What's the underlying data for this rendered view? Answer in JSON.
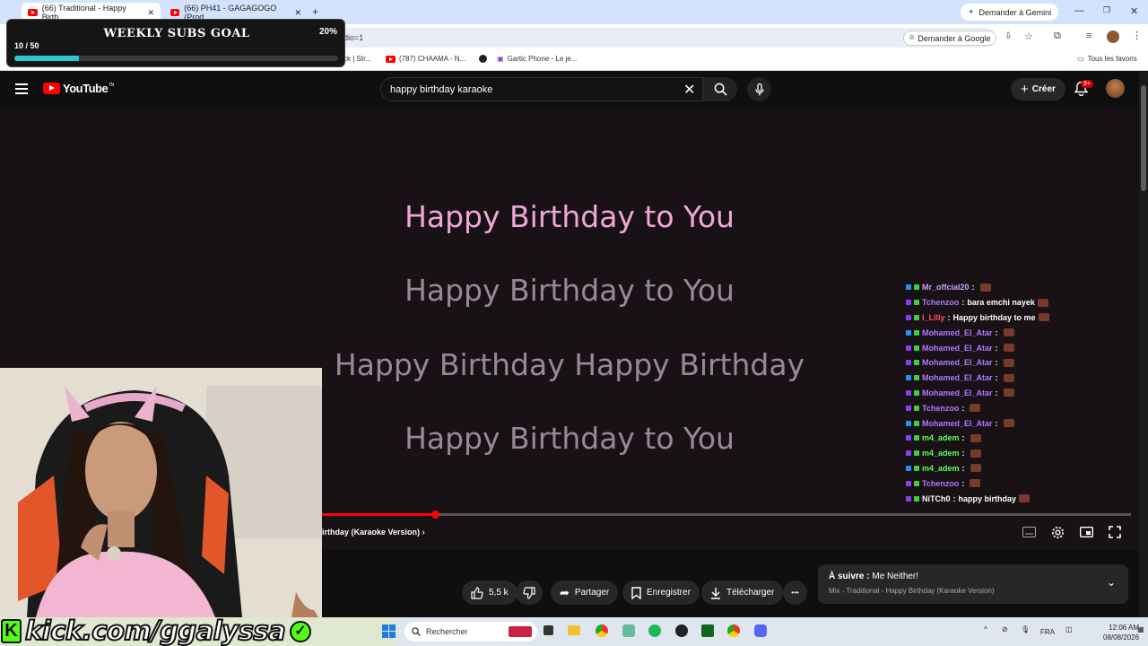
{
  "browser": {
    "tabs": [
      {
        "title": "(66) Traditional - Happy Birth"
      },
      {
        "title": "(66) PH41 - GAGAGOGO (Prod"
      }
    ],
    "new_tab": "+",
    "gemini": "Demander à Gemini",
    "url_fragment": "dio=1",
    "translate_label": "Demander à Google",
    "bookmarks": [
      "ck | Str...",
      "(787) CHAAMA - N...",
      "",
      "Gartic Phone - Le je..."
    ],
    "all_bookmarks": "Tous les favoris"
  },
  "overlay": {
    "subs_title": "WEEKLY SUBS GOAL",
    "subs_percent": "20%",
    "subs_count": "10 / 50",
    "subs_progress": 0.2,
    "kick_handle": "kick.com/ggalyssa"
  },
  "youtube": {
    "logo_text": "YouTube",
    "logo_sup": "TN",
    "search_value": "happy birthday karaoke",
    "create_label": "Créer",
    "notif_badge": "9+"
  },
  "video": {
    "lyrics": [
      {
        "text": "Happy Birthday to You",
        "color": "#f0a6d6"
      },
      {
        "text": "Happy Birthday to You",
        "color": "#9a8895"
      },
      {
        "text": "Happy Birthday Happy Birthday",
        "color": "#9a8895"
      },
      {
        "text": "Happy Birthday to You",
        "color": "#9a8895"
      }
    ],
    "title_strip": "irthday (Karaoke Version)",
    "progress": 0.14
  },
  "chat": [
    {
      "name": "Mr_offcial20",
      "msg": "",
      "color": "#c9a0ff"
    },
    {
      "name": "Tchenzoo",
      "msg": "bara emchi nayek",
      "color": "#b07aff"
    },
    {
      "name": "I_Lilly",
      "msg": "Happy birthday to me",
      "color": "#ff4d6d"
    },
    {
      "name": "Mohamed_El_Atar",
      "msg": "",
      "color": "#b07aff"
    },
    {
      "name": "Mohamed_El_Atar",
      "msg": "",
      "color": "#b07aff"
    },
    {
      "name": "Mohamed_El_Atar",
      "msg": "",
      "color": "#b07aff"
    },
    {
      "name": "Mohamed_El_Atar",
      "msg": "",
      "color": "#b07aff"
    },
    {
      "name": "Mohamed_El_Atar",
      "msg": "",
      "color": "#b07aff"
    },
    {
      "name": "Tchenzoo",
      "msg": "",
      "color": "#b07aff"
    },
    {
      "name": "Mohamed_El_Atar",
      "msg": "",
      "color": "#b07aff"
    },
    {
      "name": "m4_adem",
      "msg": "",
      "color": "#5dff5d"
    },
    {
      "name": "m4_adem",
      "msg": "",
      "color": "#5dff5d"
    },
    {
      "name": "m4_adem",
      "msg": "",
      "color": "#5dff5d"
    },
    {
      "name": "Tchenzoo",
      "msg": "",
      "color": "#b07aff"
    },
    {
      "name": "NiTCh0",
      "msg": "happy birthday",
      "color": "#ffffff"
    }
  ],
  "actions": {
    "likes": "5,5 k",
    "share": "Partager",
    "save": "Enregistrer",
    "download": "Télécharger",
    "more": "•••"
  },
  "up_next": {
    "label": "À suivre :",
    "title": "Me Neither!",
    "subtitle": "Mix - Traditional - Happy Birthday (Karaoke Version)"
  },
  "taskbar": {
    "search_placeholder": "Rechercher",
    "lang": "FRA",
    "time": "12:06 AM",
    "date": "08/08/2026"
  }
}
